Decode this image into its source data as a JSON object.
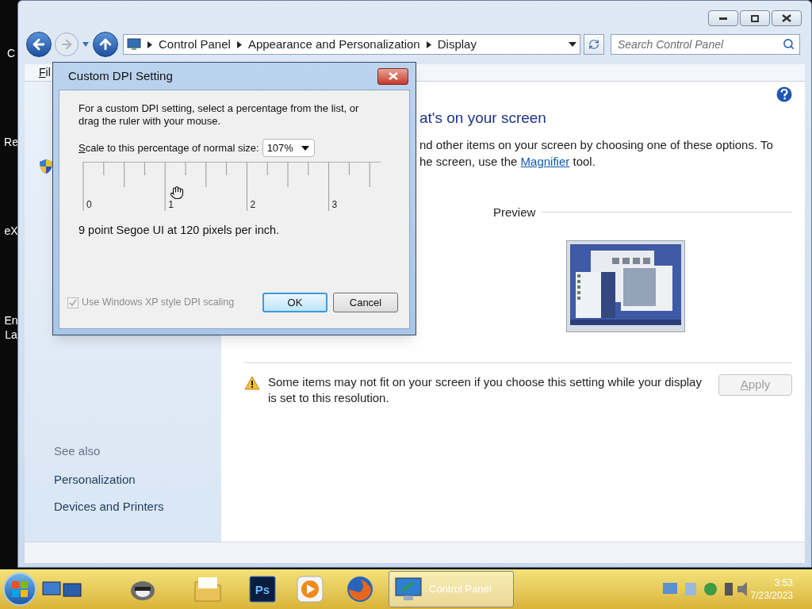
{
  "desktop": {
    "icon_labels": [
      [
        "C"
      ],
      [
        "Re"
      ],
      [
        "eX"
      ],
      [
        "En",
        "La"
      ]
    ]
  },
  "address_bar": {
    "breadcrumbs": [
      "Control Panel",
      "Appearance and Personalization",
      "Display"
    ]
  },
  "search": {
    "placeholder": "Search Control Panel"
  },
  "menu_bar": {
    "items": [
      "Fil"
    ]
  },
  "sidebar": {
    "see_also": "See also",
    "links": [
      "Personalization",
      "Devices and Printers"
    ]
  },
  "content": {
    "heading": "at's on your screen",
    "intro_line1": "nd other items on your screen by choosing one of these options. To",
    "intro_line2": "he screen, use the ",
    "link": "Magnifier",
    "intro_line2_end": " tool.",
    "preview_label": "Preview",
    "warning": "Some items may not fit on your screen if you choose this setting while your display is set to this resolution.",
    "apply": {
      "label": "Apply",
      "disabled": true
    }
  },
  "dialog": {
    "title": "Custom DPI Setting",
    "instructions": "For a custom DPI setting, select a percentage from the list, or drag the ruler with your mouse.",
    "scale_label": "Scale to this percentage of normal size:",
    "scale_value": "107%",
    "ruler_labels": [
      "0",
      "1",
      "2",
      "3"
    ],
    "sample_text": "9 point Segoe UI at 120 pixels per inch.",
    "xp_scaling": {
      "label": "Use Windows XP style DPI scaling",
      "checked": true,
      "disabled": true
    },
    "buttons": [
      {
        "label": "OK",
        "default": true
      },
      {
        "label": "Cancel",
        "default": false
      }
    ]
  },
  "taskbar": {
    "photoshop_label": "Ps",
    "active_window": {
      "label": "Control Panel",
      "selected": true
    },
    "clock": {
      "time": "3:53",
      "date": "7/23/2023"
    }
  }
}
